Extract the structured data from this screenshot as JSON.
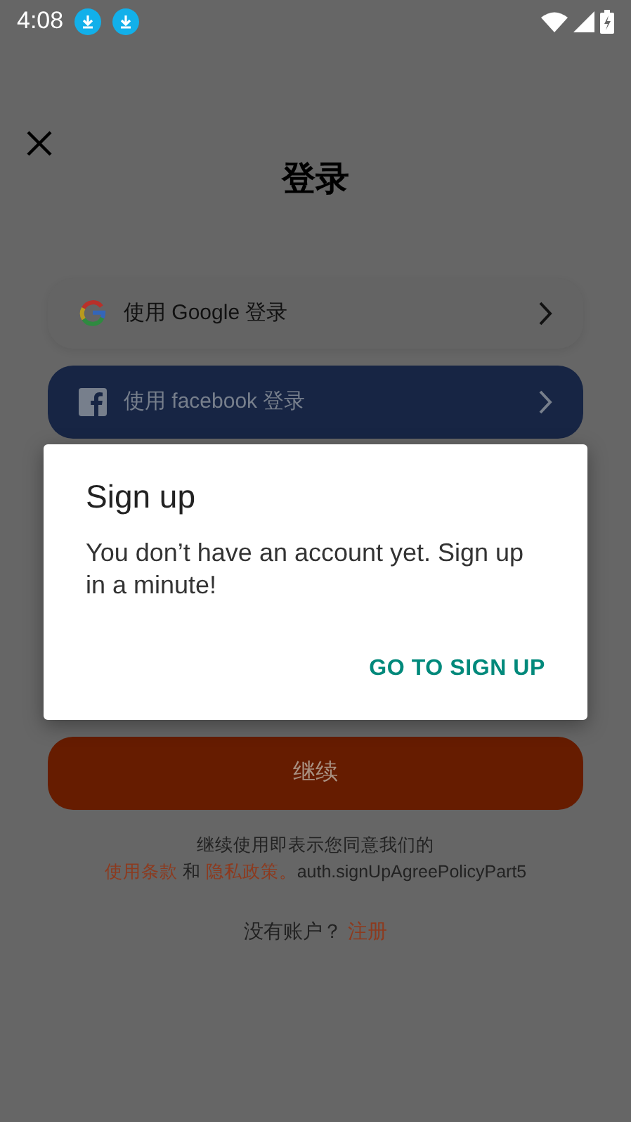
{
  "status_bar": {
    "time": "4:08"
  },
  "header": {
    "title": "登录"
  },
  "login_options": [
    {
      "kind": "google",
      "label": "使用 Google 登录"
    },
    {
      "kind": "facebook",
      "label": "使用 facebook 登录"
    }
  ],
  "continue_button": {
    "label": "继续"
  },
  "agreement": {
    "text": "继续使用即表示您同意我们的",
    "terms_link": "使用条款",
    "conjunction": "和",
    "privacy_link": "隐私政策。",
    "suffix": "auth.signUpAgreePolicyPart5"
  },
  "signup_prompt": {
    "text": "没有账户？",
    "link": "注册"
  },
  "dialog": {
    "title": "Sign up",
    "message": "You don’t have an account yet. Sign up in a minute!",
    "action": "GO TO SIGN UP"
  }
}
